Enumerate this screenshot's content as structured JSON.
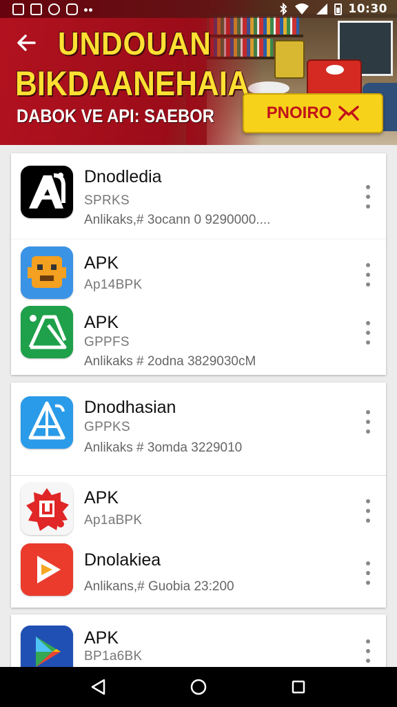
{
  "status_bar": {
    "time": "10:30",
    "icons": [
      "notification-icon",
      "notification-icon",
      "notification-icon",
      "notification-icon",
      "bluetooth-icon",
      "wifi-icon",
      "signal-icon",
      "battery-icon"
    ]
  },
  "banner": {
    "title_line1": "UNDOUAN",
    "title_line2": "BIKDAANEHAIA",
    "subtitle": "DABOK VE API: SAEBOR",
    "button_label": "PNOIRO",
    "colors": {
      "banner_red": "#b3121f",
      "title_yellow": "#ffe033",
      "button_yellow": "#f7d21a",
      "button_text": "#c0131a"
    }
  },
  "apps": [
    {
      "name": "Dnodledia",
      "sub": "SPRKS",
      "meta": "Anlikaks,# 3ocann 0 9290000....",
      "icon": "a-logo-icon"
    },
    {
      "name": "APK",
      "sub": "Ap14BPK",
      "icon": "robot-icon"
    },
    {
      "name": "APK",
      "sub": "GPPFS",
      "meta": "Anlikaks # 2odna 3829030cM",
      "icon": "green-a-icon"
    },
    {
      "name": "Dnodhasian",
      "sub": "GPPKS",
      "meta": "Anlikaks # 3omda 3229010",
      "icon": "blue-a-icon"
    },
    {
      "name": "APK",
      "sub": "Ap1aBPK",
      "icon": "red-badge-icon"
    },
    {
      "name": "Dnolakiea",
      "meta": "Anlikans,# Guobia 23:200",
      "icon": "play-triangle-icon"
    },
    {
      "name": "APK",
      "sub": "BP1a6BK",
      "icon": "play-store-icon"
    }
  ],
  "nav": {
    "icons": [
      "back-nav-icon",
      "home-nav-icon",
      "recents-nav-icon"
    ]
  }
}
